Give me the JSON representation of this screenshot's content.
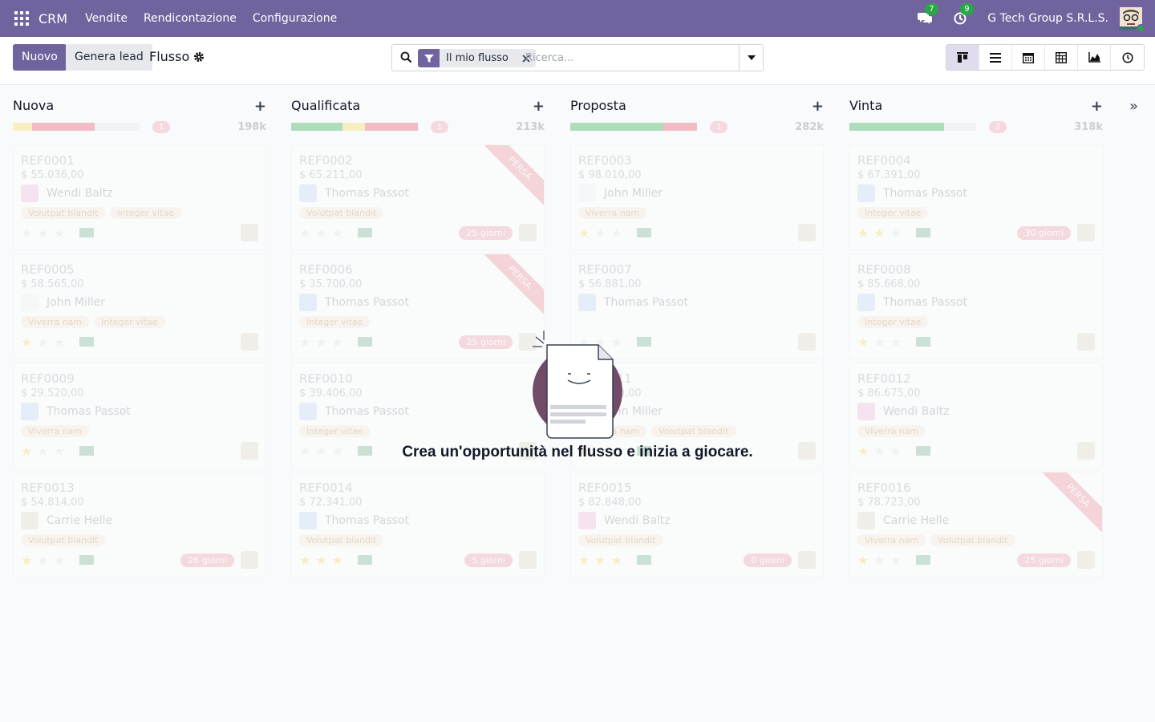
{
  "navbar": {
    "brand": "CRM",
    "menu": [
      "Vendite",
      "Rendicontazione",
      "Configurazione"
    ],
    "messages_count": "7",
    "activities_count": "9",
    "company": "G Tech Group S.R.L.S.",
    "bg_color": "#71639e"
  },
  "control": {
    "new_button": "Nuovo",
    "generate_button": "Genera lead",
    "title": "Flusso",
    "facet_label": "Il mio flusso",
    "search_placeholder": "Ricerca..."
  },
  "columns": [
    {
      "name": "Nuova",
      "count": "1",
      "sum": "198k",
      "cards": [
        {
          "ref": "REF0001",
          "amount": "$ 55.036,00",
          "contact": "Wendi Baltz",
          "tags": [
            "Volutpat blandit",
            "Integer vitae"
          ],
          "stars": 0,
          "days": "",
          "lost": false
        },
        {
          "ref": "REF0005",
          "amount": "$ 58.565,00",
          "contact": "John Miller",
          "tags": [
            "Viverra nam",
            "Integer vitae"
          ],
          "stars": 1,
          "days": "",
          "lost": false
        },
        {
          "ref": "REF0009",
          "amount": "$ 29.520,00",
          "contact": "Thomas Passot",
          "tags": [
            "Viverra nam"
          ],
          "stars": 1,
          "days": "",
          "lost": false
        },
        {
          "ref": "REF0013",
          "amount": "$ 54.814,00",
          "contact": "Carrie Helle",
          "tags": [
            "Volutpat blandit"
          ],
          "stars": 1,
          "days": "26 giorni",
          "lost": false
        }
      ]
    },
    {
      "name": "Qualificata",
      "count": "1",
      "sum": "213k",
      "cards": [
        {
          "ref": "REF0002",
          "amount": "$ 65.211,00",
          "contact": "Thomas Passot",
          "tags": [
            "Volutpat blandit"
          ],
          "stars": 0,
          "days": "25 giorni",
          "lost": true
        },
        {
          "ref": "REF0006",
          "amount": "$ 35.700,00",
          "contact": "Thomas Passot",
          "tags": [
            "Integer vitae"
          ],
          "stars": 0,
          "days": "25 giorni",
          "lost": true
        },
        {
          "ref": "REF0010",
          "amount": "$ 39.406,00",
          "contact": "Thomas Passot",
          "tags": [
            "Integer vitae"
          ],
          "stars": 0,
          "days": "",
          "lost": false
        },
        {
          "ref": "REF0014",
          "amount": "$ 72.341,00",
          "contact": "Thomas Passot",
          "tags": [
            "Volutpat blandit"
          ],
          "stars": 3,
          "days": "5 giorni",
          "lost": false
        }
      ]
    },
    {
      "name": "Proposta",
      "count": "1",
      "sum": "282k",
      "cards": [
        {
          "ref": "REF0003",
          "amount": "$ 98.010,00",
          "contact": "John Miller",
          "tags": [
            "Viverra nam"
          ],
          "stars": 1,
          "days": "",
          "lost": false
        },
        {
          "ref": "REF0007",
          "amount": "$ 56.881,00",
          "contact": "Thomas Passot",
          "tags": [],
          "stars": 0,
          "days": "",
          "lost": false
        },
        {
          "ref": "REF0011",
          "amount": "$ 44.290,00",
          "contact": "John Miller",
          "tags": [
            "Viverra nam",
            "Volutpat blandit"
          ],
          "stars": 1,
          "days": "",
          "lost": false
        },
        {
          "ref": "REF0015",
          "amount": "$ 82.848,00",
          "contact": "Wendi Baltz",
          "tags": [
            "Volutpat blandit"
          ],
          "stars": 3,
          "days": "0 giorni",
          "lost": false
        }
      ]
    },
    {
      "name": "Vinta",
      "count": "2",
      "sum": "318k",
      "cards": [
        {
          "ref": "REF0004",
          "amount": "$ 67.391,00",
          "contact": "Thomas Passot",
          "tags": [
            "Integer vitae"
          ],
          "stars": 2,
          "days": "30 giorni",
          "lost": false
        },
        {
          "ref": "REF0008",
          "amount": "$ 85.668,00",
          "contact": "Thomas Passot",
          "tags": [
            "Integer vitae"
          ],
          "stars": 1,
          "days": "",
          "lost": false
        },
        {
          "ref": "REF0012",
          "amount": "$ 86.675,00",
          "contact": "Wendi Baltz",
          "tags": [
            "Viverra nam"
          ],
          "stars": 1,
          "days": "",
          "lost": false
        },
        {
          "ref": "REF0016",
          "amount": "$ 78.723,00",
          "contact": "Carrie Helle",
          "tags": [
            "Viverra nam",
            "Volutpat blandit"
          ],
          "stars": 1,
          "days": "25 giorni",
          "lost": true
        }
      ]
    }
  ],
  "lost_ribbon": "PERSA",
  "helper": {
    "text": "Crea un'opportunità nel flusso e inizia a giocare."
  }
}
